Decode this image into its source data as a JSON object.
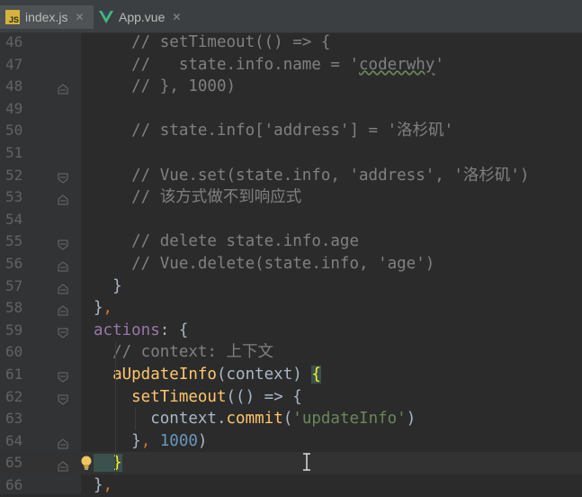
{
  "tabs": [
    {
      "label": "index.js",
      "icon": "javascript-file-icon",
      "active": true
    },
    {
      "label": "App.vue",
      "icon": "vue-file-icon",
      "active": false
    }
  ],
  "lines": [
    {
      "num": "46",
      "tokens": [
        [
          "cm",
          "    // setTimeout(() => {"
        ]
      ]
    },
    {
      "num": "47",
      "tokens": [
        [
          "cm",
          "    //   state.info.name = '"
        ],
        [
          "cm wavy",
          "coderwhy"
        ],
        [
          "cm",
          "'"
        ]
      ]
    },
    {
      "num": "48",
      "tokens": [
        [
          "cm",
          "    // }, 1000)"
        ]
      ]
    },
    {
      "num": "49",
      "tokens": []
    },
    {
      "num": "50",
      "tokens": [
        [
          "cm",
          "    // state.info['address'] = '洛杉矶'"
        ]
      ]
    },
    {
      "num": "51",
      "tokens": []
    },
    {
      "num": "52",
      "tokens": [
        [
          "cm",
          "    // Vue.set(state.info, 'address', '洛杉矶')"
        ]
      ]
    },
    {
      "num": "53",
      "tokens": [
        [
          "cm",
          "    // 该方式做不到响应式"
        ]
      ]
    },
    {
      "num": "54",
      "tokens": []
    },
    {
      "num": "55",
      "tokens": [
        [
          "cm",
          "    // delete state.info.age"
        ]
      ]
    },
    {
      "num": "56",
      "tokens": [
        [
          "cm",
          "    // Vue.delete(state.info, 'age')"
        ]
      ]
    },
    {
      "num": "57",
      "tokens": [
        [
          "",
          "  }"
        ]
      ]
    },
    {
      "num": "58",
      "tokens": [
        [
          "",
          "}"
        ],
        [
          "kw",
          ","
        ]
      ]
    },
    {
      "num": "59",
      "tokens": [
        [
          "pr",
          "actions"
        ],
        [
          "",
          ": {"
        ]
      ]
    },
    {
      "num": "60",
      "tokens": [
        [
          "cm",
          "  // context: 上下文"
        ]
      ]
    },
    {
      "num": "61",
      "tokens": [
        [
          "fn",
          "  aUpdateInfo"
        ],
        [
          "",
          "(context) "
        ],
        [
          "brace-hl",
          "{"
        ]
      ]
    },
    {
      "num": "62",
      "tokens": [
        [
          "fn",
          "    setTimeout"
        ],
        [
          "",
          "(() => {"
        ]
      ]
    },
    {
      "num": "63",
      "tokens": [
        [
          "",
          "      context."
        ],
        [
          "fn",
          "commit"
        ],
        [
          "",
          "("
        ],
        [
          "str",
          "'updateInfo'"
        ],
        [
          "",
          ")"
        ]
      ]
    },
    {
      "num": "64",
      "tokens": [
        [
          "",
          "    }"
        ],
        [
          "kw",
          ", "
        ],
        [
          "num",
          "1000"
        ],
        [
          "",
          ")"
        ]
      ]
    },
    {
      "num": "65",
      "tokens": [
        [
          "brace-hl",
          "  }"
        ]
      ]
    },
    {
      "num": "66",
      "tokens": [
        [
          "",
          "}"
        ],
        [
          "kw",
          ","
        ]
      ]
    }
  ],
  "colors": {
    "background": "#2b2b2b",
    "comment": "#808080",
    "keyword": "#cc7832",
    "function": "#ffc66d",
    "property": "#9876aa",
    "string": "#6a8759",
    "number": "#6897bb"
  },
  "gutter_icons": {
    "fold_marker": "fold-marker-icon",
    "intention": "lightbulb-icon"
  }
}
